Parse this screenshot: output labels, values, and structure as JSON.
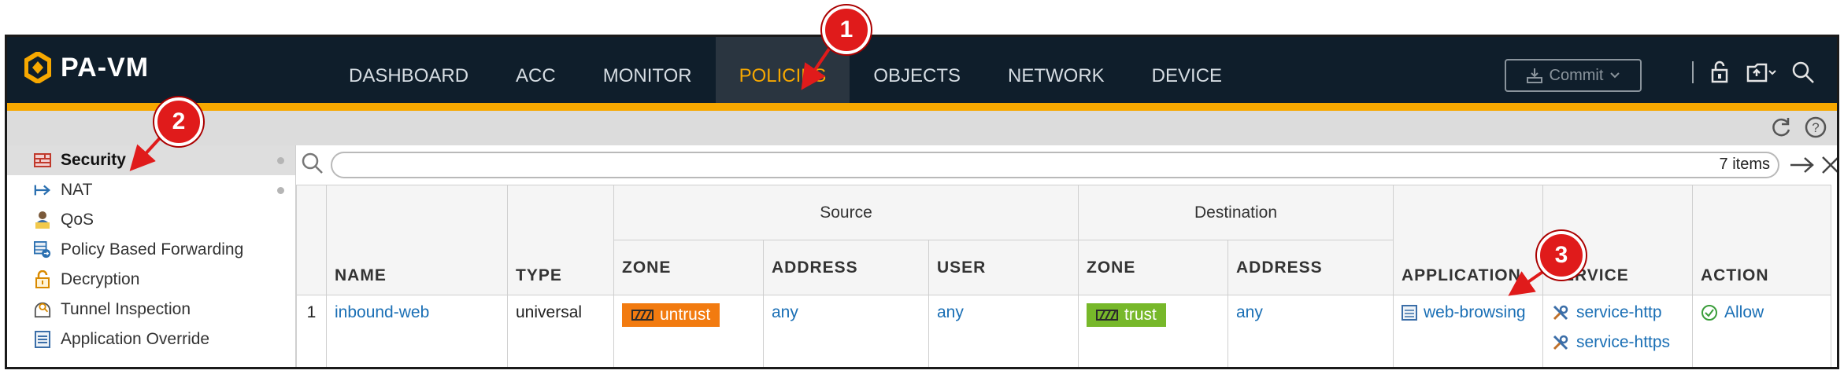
{
  "app": {
    "name": "PA-VM"
  },
  "nav": [
    "DASHBOARD",
    "ACC",
    "MONITOR",
    "POLICIES",
    "OBJECTS",
    "NETWORK",
    "DEVICE"
  ],
  "nav_active": "POLICIES",
  "commit_label": "Commit",
  "sidebar": {
    "items": [
      {
        "label": "Security",
        "icon": "security-policy-icon"
      },
      {
        "label": "NAT",
        "icon": "nat-icon"
      },
      {
        "label": "QoS",
        "icon": "qos-icon"
      },
      {
        "label": "Policy Based Forwarding",
        "icon": "pbf-icon"
      },
      {
        "label": "Decryption",
        "icon": "decryption-icon"
      },
      {
        "label": "Tunnel Inspection",
        "icon": "tunnel-icon"
      },
      {
        "label": "Application Override",
        "icon": "app-override-icon"
      }
    ]
  },
  "filter": {
    "items_count": "7 items"
  },
  "table": {
    "group_source": "Source",
    "group_destination": "Destination",
    "headers": {
      "name": "NAME",
      "type": "TYPE",
      "src_zone": "ZONE",
      "src_address": "ADDRESS",
      "src_user": "USER",
      "dst_zone": "ZONE",
      "dst_address": "ADDRESS",
      "application": "APPLICATION",
      "service": "SERVICE",
      "action": "ACTION"
    },
    "rows": [
      {
        "num": "1",
        "name": "inbound-web",
        "type": "universal",
        "src_zone": "untrust",
        "src_address": "any",
        "src_user": "any",
        "dst_zone": "trust",
        "dst_address": "any",
        "application": "web-browsing",
        "service": [
          "service-http",
          "service-https"
        ],
        "action": "Allow"
      }
    ]
  },
  "callouts": [
    "1",
    "2",
    "3"
  ],
  "colors": {
    "accent": "#f7a800",
    "untrust": "#f27b10",
    "trust": "#77b82a",
    "callout": "#e01b1b",
    "link": "#1a6fb5"
  }
}
